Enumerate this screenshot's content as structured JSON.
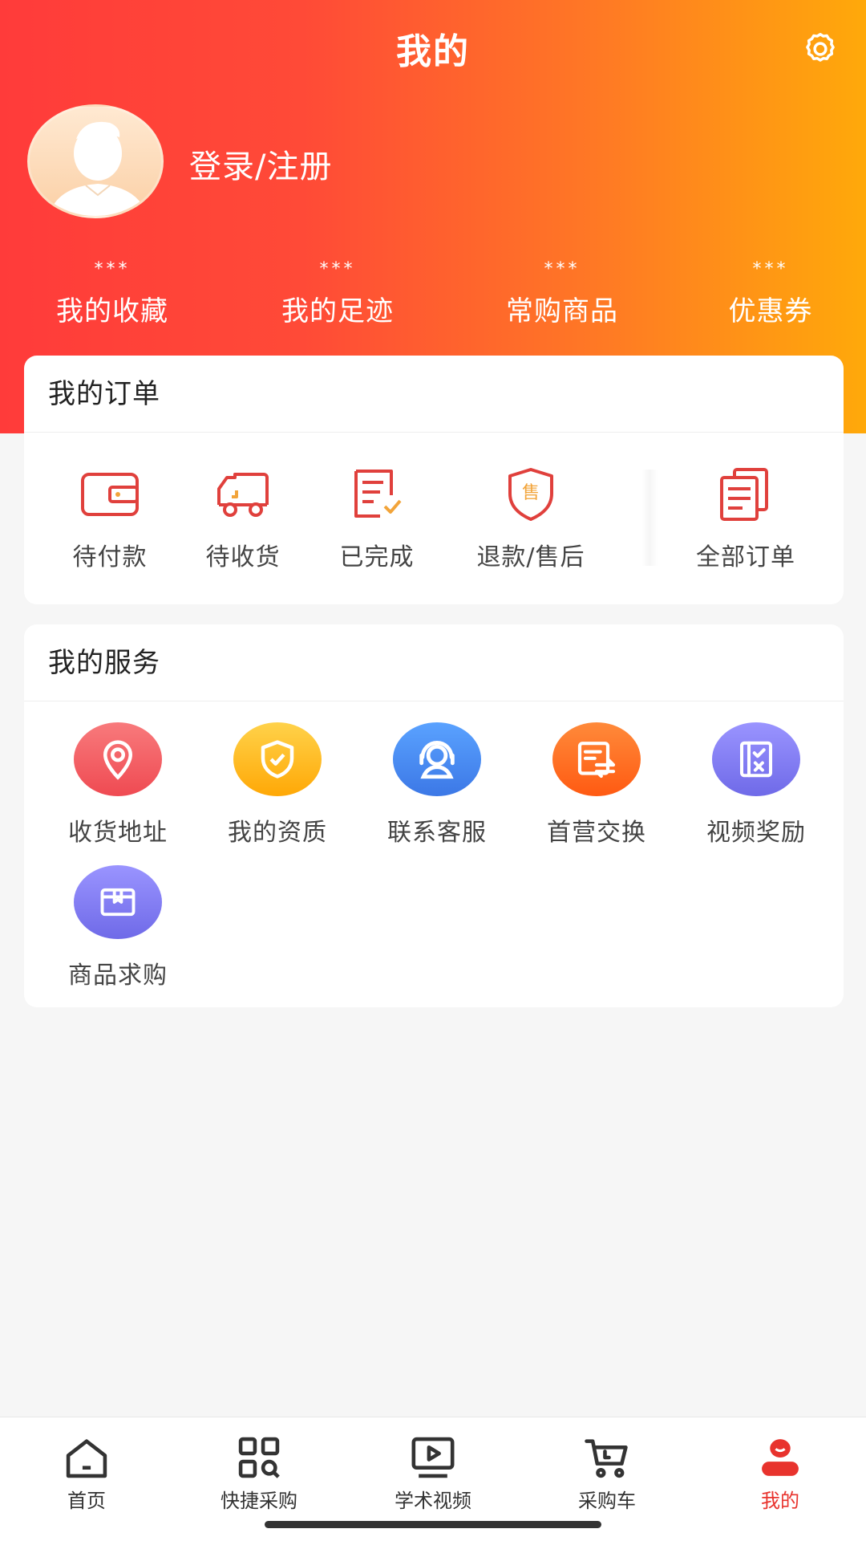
{
  "header": {
    "title": "我的",
    "settings_icon": "gear-icon"
  },
  "profile": {
    "login_label": "登录/注册",
    "avatar_icon": "default-avatar"
  },
  "stats": [
    {
      "value": "***",
      "label": "我的收藏"
    },
    {
      "value": "***",
      "label": "我的足迹"
    },
    {
      "value": "***",
      "label": "常购商品"
    },
    {
      "value": "***",
      "label": "优惠券"
    }
  ],
  "orders": {
    "title": "我的订单",
    "items": [
      {
        "label": "待付款",
        "icon": "wallet-icon"
      },
      {
        "label": "待收货",
        "icon": "truck-icon"
      },
      {
        "label": "已完成",
        "icon": "completed-doc-icon"
      },
      {
        "label": "退款/售后",
        "icon": "after-sale-shield-icon"
      },
      {
        "label": "全部订单",
        "icon": "all-orders-icon"
      }
    ]
  },
  "services": {
    "title": "我的服务",
    "items": [
      {
        "label": "收货地址",
        "icon": "location-pin-icon",
        "color": "#f2565a"
      },
      {
        "label": "我的资质",
        "icon": "shield-check-icon",
        "color": "#ffb80b"
      },
      {
        "label": "联系客服",
        "icon": "customer-service-icon",
        "color": "#4b8ff4"
      },
      {
        "label": "首营交换",
        "icon": "exchange-icon",
        "color": "#ff6a1b"
      },
      {
        "label": "视频奖励",
        "icon": "checklist-icon",
        "color": "#7c78f2"
      },
      {
        "label": "商品求购",
        "icon": "box-icon",
        "color": "#7c78f2"
      }
    ]
  },
  "tabbar": {
    "active_color": "#e8332d",
    "items": [
      {
        "label": "首页",
        "icon": "home-icon"
      },
      {
        "label": "快捷采购",
        "icon": "qr-scan-icon"
      },
      {
        "label": "学术视频",
        "icon": "video-play-icon"
      },
      {
        "label": "采购车",
        "icon": "cart-icon"
      },
      {
        "label": "我的",
        "icon": "profile-icon",
        "active": true
      }
    ]
  }
}
